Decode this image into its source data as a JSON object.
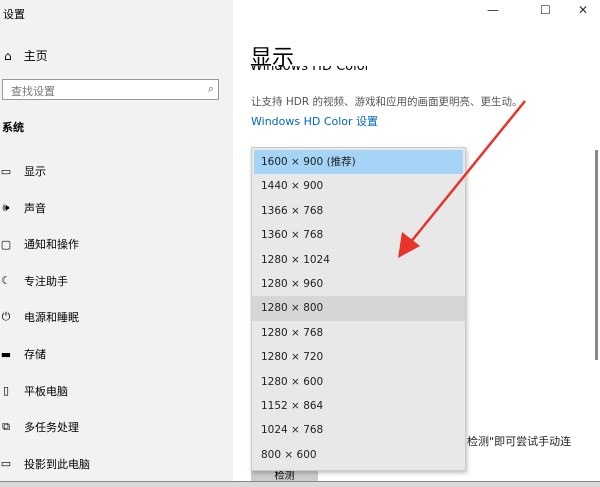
{
  "window": {
    "title": "设置",
    "minimize": "—",
    "maximize": "☐",
    "close": "✕"
  },
  "sidebar": {
    "home": "主页",
    "search_placeholder": "查找设置",
    "section": "系统",
    "items": [
      {
        "icon": "monitor-icon",
        "glyph": "▭",
        "label": "显示"
      },
      {
        "icon": "speaker-icon",
        "glyph": "🕪",
        "label": "声音"
      },
      {
        "icon": "notification-icon",
        "glyph": "▢",
        "label": "通知和操作"
      },
      {
        "icon": "moon-icon",
        "glyph": "☾",
        "label": "专注助手"
      },
      {
        "icon": "power-icon",
        "glyph": "⏻",
        "label": "电源和睡眠"
      },
      {
        "icon": "storage-icon",
        "glyph": "▬",
        "label": "存储"
      },
      {
        "icon": "tablet-icon",
        "glyph": "▯",
        "label": "平板电脑"
      },
      {
        "icon": "multitask-icon",
        "glyph": "⧉",
        "label": "多任务处理"
      },
      {
        "icon": "project-icon",
        "glyph": "▭",
        "label": "投影到此电脑"
      }
    ]
  },
  "main": {
    "title": "显示",
    "hdr_heading": "Windows HD Color",
    "hdr_desc": "让支持 HDR 的视频、游戏和应用的画面更明亮、更生动。",
    "hdr_link": "Windows HD Color 设置",
    "trailing_text": "\"检测\"即可尝试手动连",
    "detect_button": "检测"
  },
  "resolution_dropdown": {
    "selected": 0,
    "hovered": 6,
    "options": [
      "1600 × 900 (推荐)",
      "1440 × 900",
      "1366 × 768",
      "1360 × 768",
      "1280 × 1024",
      "1280 × 960",
      "1280 × 800",
      "1280 × 768",
      "1280 × 720",
      "1280 × 600",
      "1152 × 864",
      "1024 × 768",
      "800 × 600"
    ]
  },
  "colors": {
    "accent": "#0067c0",
    "selection": "#a6d4f7",
    "arrow": "#e8322a"
  }
}
